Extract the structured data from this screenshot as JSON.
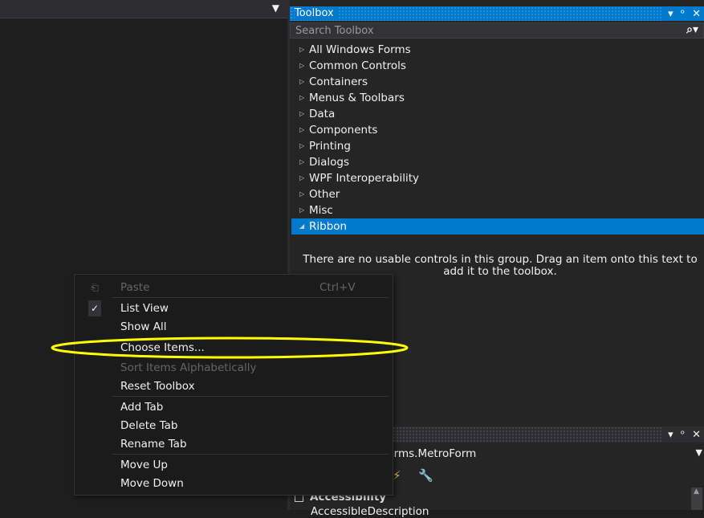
{
  "toolbox": {
    "title": "Toolbox",
    "controls": [
      "▾",
      "ᵒ",
      "✕"
    ],
    "search_placeholder": "Search Toolbox",
    "search_icon": "search-icon",
    "groups": [
      {
        "label": "All Windows Forms",
        "expanded": false
      },
      {
        "label": "Common Controls",
        "expanded": false
      },
      {
        "label": "Containers",
        "expanded": false
      },
      {
        "label": "Menus & Toolbars",
        "expanded": false
      },
      {
        "label": "Data",
        "expanded": false
      },
      {
        "label": "Components",
        "expanded": false
      },
      {
        "label": "Printing",
        "expanded": false
      },
      {
        "label": "Dialogs",
        "expanded": false
      },
      {
        "label": "WPF Interoperability",
        "expanded": false
      },
      {
        "label": "Other",
        "expanded": false
      },
      {
        "label": "Misc",
        "expanded": false
      },
      {
        "label": "Ribbon",
        "expanded": true
      }
    ],
    "empty_message": "There are no usable controls in this group. Drag an item onto this text to add it to the toolbox.",
    "accent_color": "#007acc"
  },
  "properties": {
    "object_selector": "etroFramework.Forms.MetroForm",
    "category": "Accessibility",
    "first_property": "AccessibleDescription"
  },
  "context_menu": {
    "items": [
      {
        "label": "Paste",
        "shortcut": "Ctrl+V",
        "enabled": false,
        "icon": "paste-icon"
      },
      {
        "label": "List View",
        "enabled": true,
        "checked": true,
        "icon": "checkmark-icon"
      },
      {
        "label": "Show All",
        "enabled": true
      },
      {
        "label": "Choose Items...",
        "enabled": true,
        "highlighted": true
      },
      {
        "label": "Sort Items Alphabetically",
        "enabled": false
      },
      {
        "label": "Reset Toolbox",
        "enabled": true
      },
      {
        "label": "Add Tab",
        "enabled": true
      },
      {
        "label": "Delete Tab",
        "enabled": true
      },
      {
        "label": "Rename Tab",
        "enabled": true
      },
      {
        "label": "Move Up",
        "enabled": true
      },
      {
        "label": "Move Down",
        "enabled": true
      }
    ],
    "annotation_color": "#ffff00"
  }
}
